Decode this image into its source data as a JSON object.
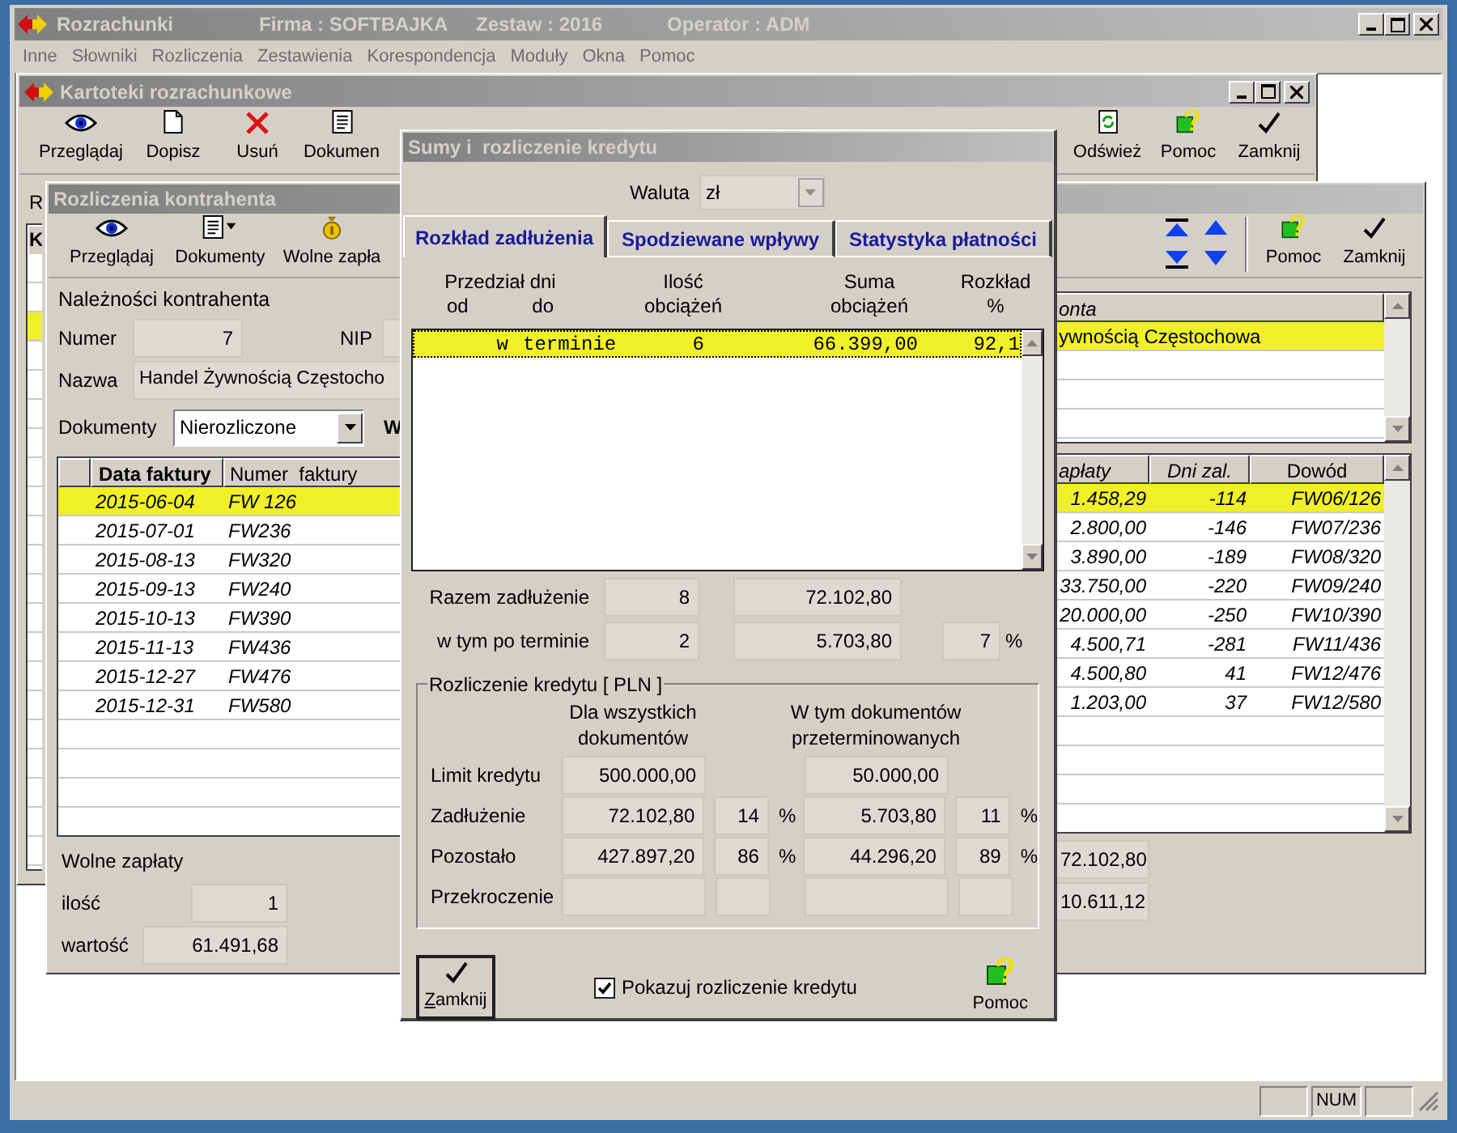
{
  "app": {
    "title": "Rozrachunki",
    "company": "Firma : SOFTBAJKA",
    "set": "Zestaw : 2016",
    "operator": "Operator : ADM"
  },
  "menu": [
    "Inne",
    "Słowniki",
    "Rozliczenia",
    "Zestawienia",
    "Korespondencja",
    "Moduły",
    "Okna",
    "Pomoc"
  ],
  "cards_window": {
    "title": "Kartoteki rozrachunkowe",
    "toolbar_left": [
      {
        "label": "Przeglądaj",
        "kind": "eye"
      },
      {
        "label": "Dopisz",
        "kind": "page"
      },
      {
        "label": "Usuń",
        "kind": "delete"
      },
      {
        "label": "Dokumen",
        "kind": "doc"
      }
    ],
    "toolbar_right": [
      {
        "label": "Odśwież",
        "kind": "refresh"
      },
      {
        "label": "Pomoc",
        "kind": "help"
      },
      {
        "label": "Zamknij",
        "kind": "check"
      }
    ],
    "label": "R",
    "grid_header": "K",
    "grid_rows": [
      {
        "selected": false
      },
      {
        "selected": false
      },
      {
        "selected": true
      },
      {
        "selected": false
      },
      {
        "selected": false
      },
      {
        "selected": false
      },
      {
        "selected": false
      },
      {
        "selected": false
      },
      {
        "selected": false
      },
      {
        "selected": false
      },
      {
        "selected": false
      },
      {
        "selected": false
      },
      {
        "selected": false
      },
      {
        "selected": false
      },
      {
        "selected": false
      },
      {
        "selected": false
      },
      {
        "selected": false
      },
      {
        "selected": false
      },
      {
        "selected": false
      },
      {
        "selected": false
      },
      {
        "selected": false
      }
    ]
  },
  "partner_window": {
    "title": "Rozliczenia kontrahenta",
    "toolbar_left": [
      {
        "label": "Przeglądaj",
        "kind": "eye"
      },
      {
        "label": "Dokumenty",
        "kind": "docmenu"
      },
      {
        "label": "Wolne zapła",
        "kind": "moneybag"
      }
    ],
    "nav_buttons": [
      {
        "kind": "first"
      },
      {
        "kind": "prev"
      },
      {
        "kind": "last"
      },
      {
        "kind": "next"
      }
    ],
    "toolbar_right": [
      {
        "label": "Pomoc",
        "kind": "help"
      },
      {
        "label": "Zamknij",
        "kind": "check"
      }
    ],
    "section_label": "Należności kontrahenta",
    "number_label": "Numer",
    "number": "7",
    "nip_label": "NIP",
    "name_label": "Nazwa",
    "name": "Handel Żywnością Częstocho",
    "documents_label": "Dokumenty",
    "documents_filter": "Nierozliczone",
    "cut_label": "W",
    "accounts_grid": {
      "column": "onta",
      "rows": [
        {
          "name": "ywnością Częstochowa",
          "selected": true
        },
        {
          "selected": false
        },
        {
          "selected": false
        },
        {
          "selected": false
        }
      ]
    },
    "invoices": {
      "columns_left": [
        "Data faktury",
        "Numer  faktury"
      ],
      "columns_right": [
        "apłaty",
        "Dni zal.",
        "Dowód"
      ],
      "rows": [
        {
          "date": "2015-06-04",
          "number": "FW 126",
          "amount": "1.458,29",
          "days": "-114",
          "proof": "FW06/126",
          "selected": true
        },
        {
          "date": "2015-07-01",
          "number": "FW236",
          "amount": "2.800,00",
          "days": "-146",
          "proof": "FW07/236",
          "selected": false
        },
        {
          "date": "2015-08-13",
          "number": "FW320",
          "amount": "3.890,00",
          "days": "-189",
          "proof": "FW08/320",
          "selected": false
        },
        {
          "date": "2015-09-13",
          "number": "FW240",
          "amount": "33.750,00",
          "days": "-220",
          "proof": "FW09/240",
          "selected": false
        },
        {
          "date": "2015-10-13",
          "number": "FW390",
          "amount": "20.000,00",
          "days": "-250",
          "proof": "FW10/390",
          "selected": false
        },
        {
          "date": "2015-11-13",
          "number": "FW436",
          "amount": "4.500,71",
          "days": "-281",
          "proof": "FW11/436",
          "selected": false
        },
        {
          "date": "2015-12-27",
          "number": "FW476",
          "amount": "4.500,80",
          "days": "41",
          "proof": "FW12/476",
          "selected": false
        },
        {
          "date": "2015-12-31",
          "number": "FW580",
          "amount": "1.203,00",
          "days": "37",
          "proof": "FW12/580",
          "selected": false
        }
      ]
    },
    "free_payments": {
      "title": "Wolne zapłaty",
      "count_label": "ilość",
      "count": "1",
      "value_label": "wartość",
      "value": "61.491,68"
    },
    "totals": [
      "72.102,80",
      "10.611,12"
    ]
  },
  "dialog": {
    "title": "Sumy i  rozliczenie kredytu",
    "currency_label": "Waluta",
    "currency": "zł",
    "tabs": [
      {
        "label": "Rozkład zadłużenia",
        "selected": true
      },
      {
        "label": "Spodziewane wpływy",
        "selected": false
      },
      {
        "label": "Statystyka płatności",
        "selected": false
      }
    ],
    "range_header": "Przedział dni",
    "from_header": "od",
    "to_header": "do",
    "count_header": [
      "Ilość",
      "obciążeń"
    ],
    "sum_header": [
      "Suma",
      "obciążeń"
    ],
    "share_header": [
      "Rozkład",
      "%"
    ],
    "rows": [
      {
        "from": "w",
        "to": "terminie",
        "count": "6",
        "sum": "66.399,00",
        "share": "92,1",
        "selected": true
      }
    ],
    "total_label": "Razem zadłużenie",
    "total_count": "8",
    "total_sum": "72.102,80",
    "overdue_label": "w tym po terminie",
    "overdue_count": "2",
    "overdue_sum": "5.703,80",
    "overdue_share": "7",
    "overdue_sign": "%",
    "credit": {
      "title": "Rozliczenie kredytu [ PLN ]",
      "col_all": "Dla wszystkich dokumentów",
      "col_overdue": "W tym dokumentów przeterminowanych",
      "rows": [
        {
          "kind": "limit",
          "label": "Limit kredytu",
          "all": "500.000,00",
          "overdue": "50.000,00"
        },
        {
          "kind": "share",
          "label": "Zadłużenie",
          "all": "72.102,80",
          "all_pct": "14",
          "all_sign": "%",
          "overdue": "5.703,80",
          "overdue_pct": "11",
          "overdue_sign": "%"
        },
        {
          "kind": "share",
          "label": "Pozostało",
          "all": "427.897,20",
          "all_pct": "86",
          "all_sign": "%",
          "overdue": "44.296,20",
          "overdue_pct": "89",
          "overdue_sign": "%"
        },
        {
          "kind": "blank",
          "label": "Przekroczenie"
        }
      ]
    },
    "close_button": "Zamknij",
    "show_credit": {
      "label": "Pokazuj rozliczenie kredytu",
      "checked": true
    },
    "help_button": "Pomoc"
  },
  "status_bar": [
    {
      "kind": "empty"
    },
    {
      "kind": "text",
      "text": "NUM"
    },
    {
      "kind": "empty"
    }
  ]
}
